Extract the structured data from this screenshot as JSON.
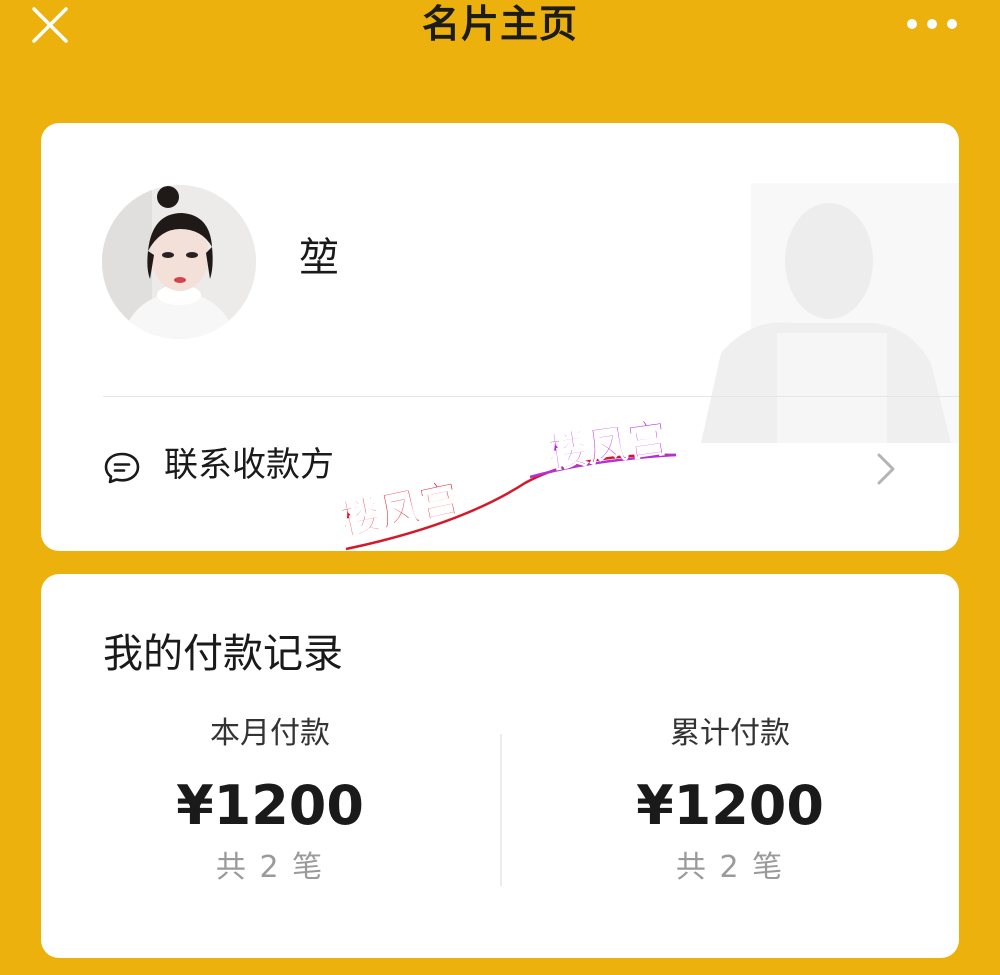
{
  "header": {
    "title": "名片主页",
    "close_icon": "close-icon",
    "more_icon": "more-icon"
  },
  "profile": {
    "name": "堃",
    "avatar_icon": "avatar-photo"
  },
  "contact": {
    "label": "联系收款方",
    "icon": "chat-bubble-icon",
    "chevron": "chevron-right-icon"
  },
  "watermark": {
    "text_1": "楼凤宫",
    "text_2": "楼凤宫"
  },
  "payments": {
    "title": "我的付款记录",
    "monthly": {
      "label": "本月付款",
      "amount": "¥1200",
      "count": "共 2 笔"
    },
    "total": {
      "label": "累计付款",
      "amount": "¥1200",
      "count": "共 2 笔"
    }
  },
  "colors": {
    "background": "#ECB10C",
    "card": "#FFFFFF",
    "muted_text": "#9A9A9A"
  }
}
